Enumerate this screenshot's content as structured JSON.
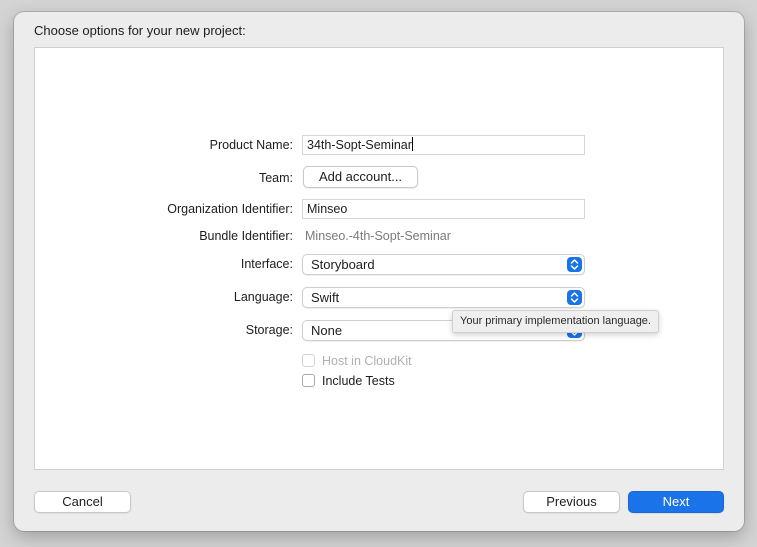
{
  "dialog": {
    "heading": "Choose options for your new project:"
  },
  "form": {
    "product_name": {
      "label": "Product Name:",
      "value": "34th-Sopt-Seminar"
    },
    "team": {
      "label": "Team:",
      "button_label": "Add account..."
    },
    "organization_identifier": {
      "label": "Organization Identifier:",
      "value": "Minseo"
    },
    "bundle_identifier": {
      "label": "Bundle Identifier:",
      "value": "Minseo.-4th-Sopt-Seminar"
    },
    "interface": {
      "label": "Interface:",
      "value": "Storyboard"
    },
    "language": {
      "label": "Language:",
      "value": "Swift"
    },
    "storage": {
      "label": "Storage:",
      "value": "None"
    },
    "host_in_cloudkit": {
      "label": "Host in CloudKit",
      "checked": false,
      "enabled": false
    },
    "include_tests": {
      "label": "Include Tests",
      "checked": false,
      "enabled": true
    }
  },
  "tooltip": {
    "text": "Your primary implementation language."
  },
  "footer": {
    "cancel_label": "Cancel",
    "previous_label": "Previous",
    "next_label": "Next"
  },
  "colors": {
    "accent": "#1a73e8",
    "sheet_background": "#ececec",
    "panel_background": "#ffffff"
  },
  "icons": {
    "popup_indicator": "chevron-up-down-icon"
  }
}
